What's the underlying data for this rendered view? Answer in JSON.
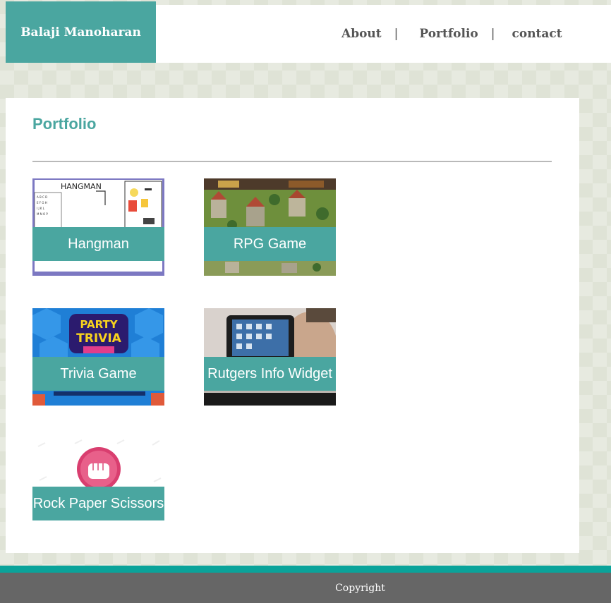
{
  "header": {
    "brand": "Balaji Manoharan",
    "nav": {
      "about": "About",
      "separator": "|",
      "portfolio": "Portfolio",
      "contact": "contact"
    }
  },
  "main": {
    "title": "Portfolio",
    "projects": [
      {
        "label": "Hangman",
        "icon": "hangman-thumbnail"
      },
      {
        "label": "RPG Game",
        "icon": "rpg-game-thumbnail"
      },
      {
        "label": "Trivia Game",
        "icon": "trivia-game-thumbnail"
      },
      {
        "label": "Rutgers Info Widget",
        "icon": "tablet-widget-thumbnail"
      },
      {
        "label": "Rock Paper Scissors",
        "icon": "fist-thumbnail"
      }
    ]
  },
  "footer": {
    "text": "Copyright"
  },
  "colors": {
    "accent": "#4aa6a0",
    "footer_bar": "#0aa39a",
    "footer": "#666666",
    "background": "#dfe3d6"
  }
}
